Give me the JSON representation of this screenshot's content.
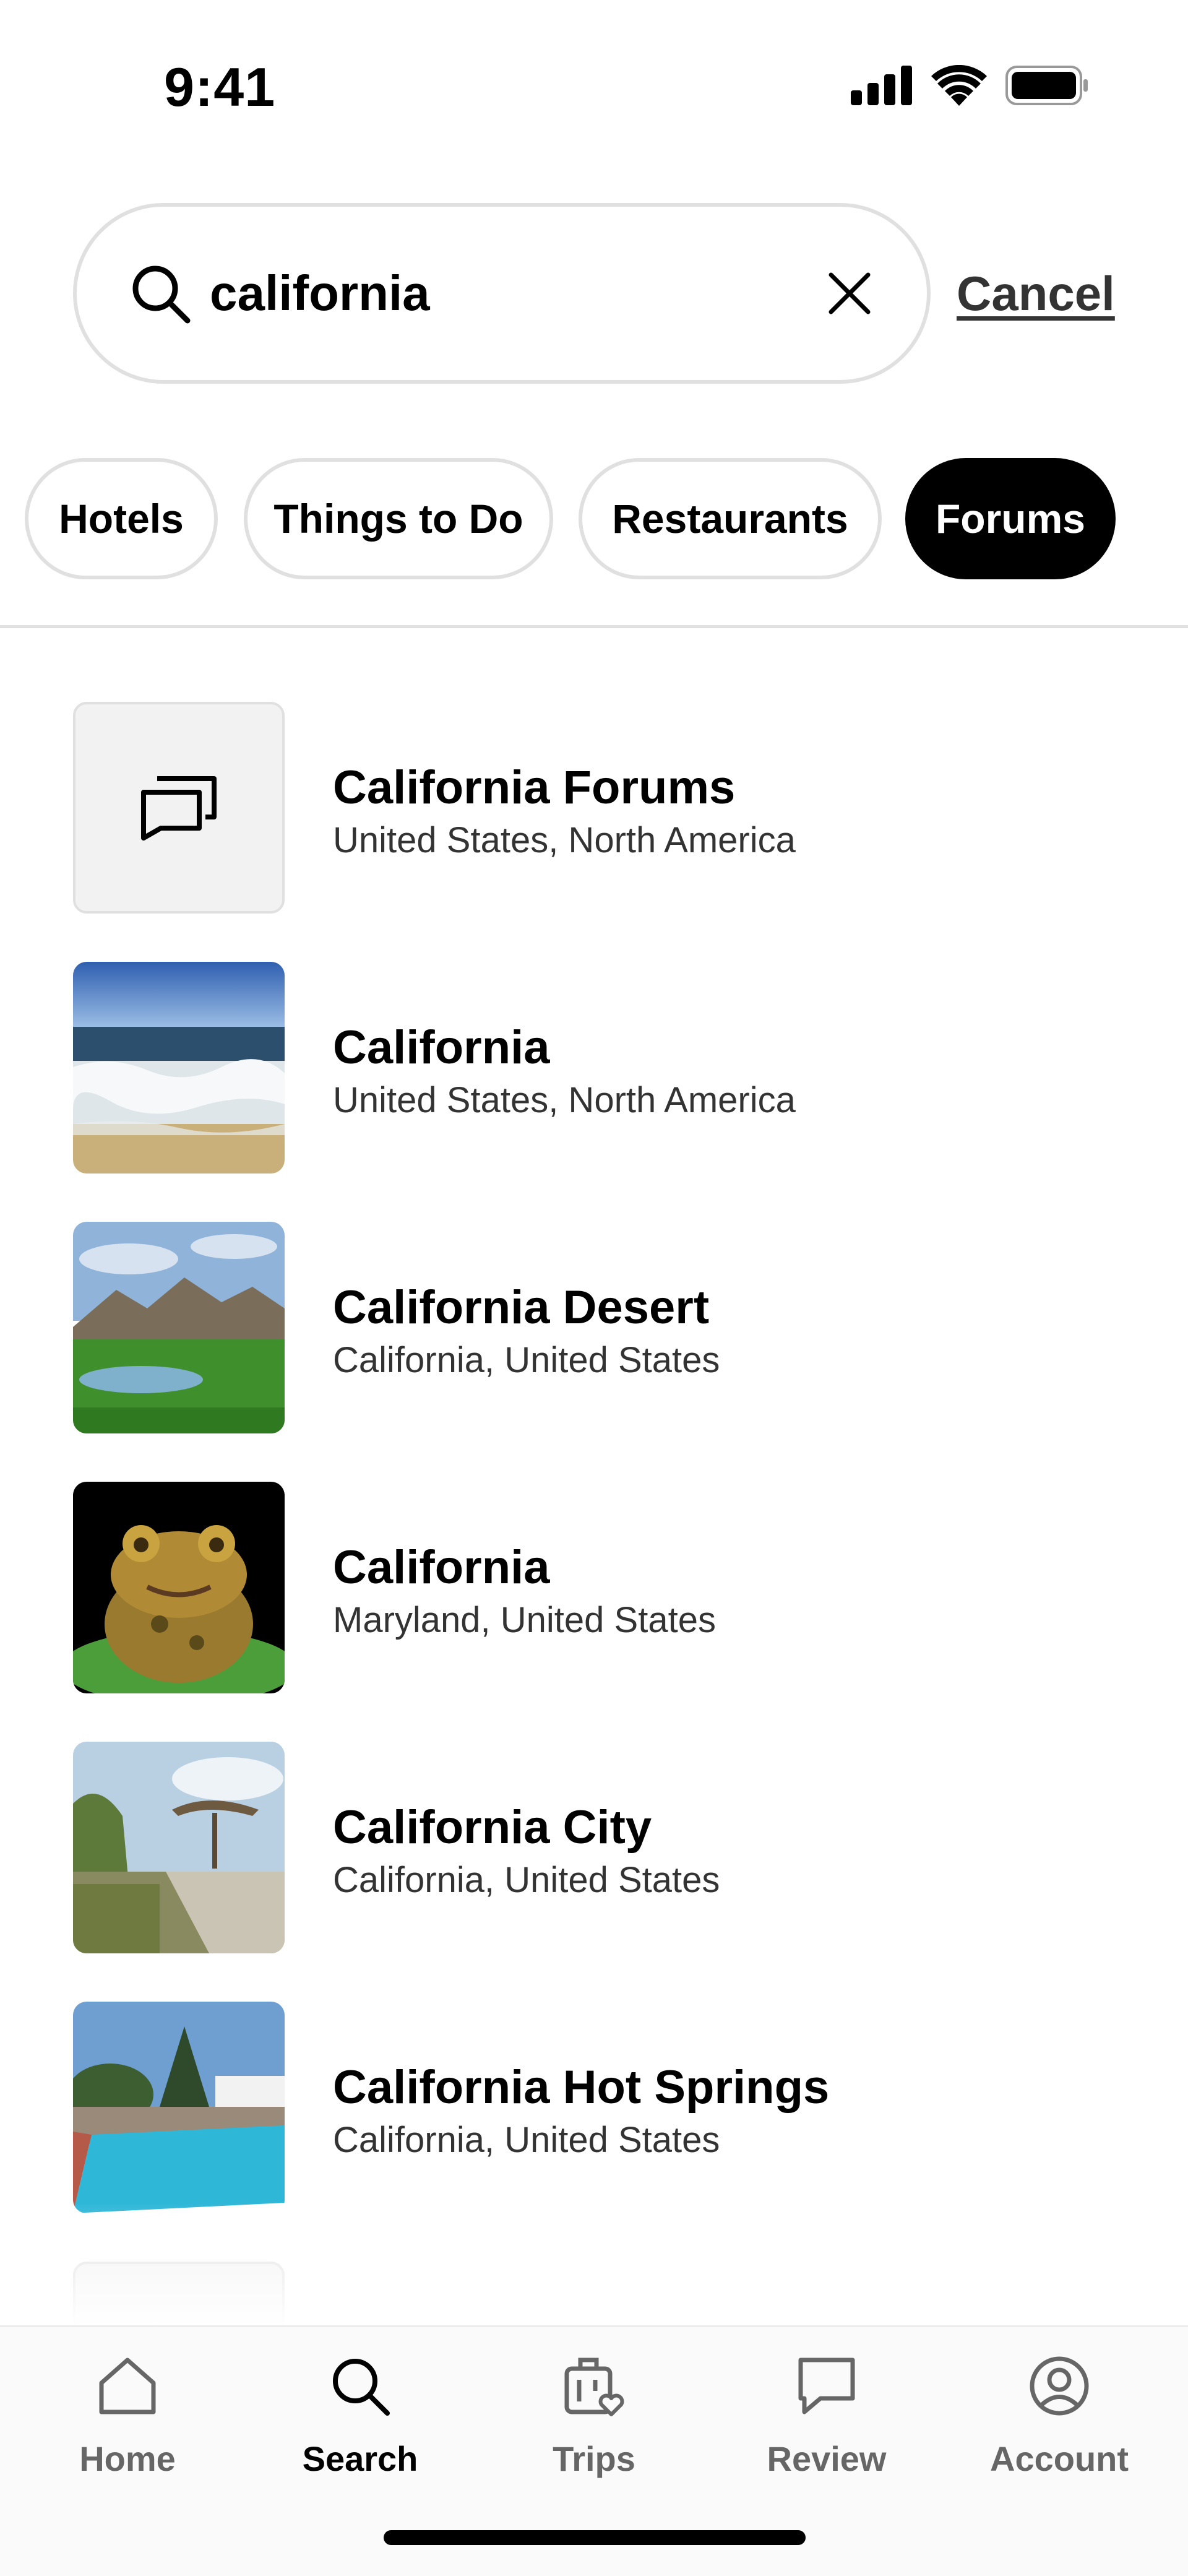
{
  "status_bar": {
    "time": "9:41"
  },
  "search": {
    "value": "california",
    "cancel_label": "Cancel"
  },
  "filters": [
    {
      "label": "Hotels",
      "active": false
    },
    {
      "label": "Things to Do",
      "active": false
    },
    {
      "label": "Restaurants",
      "active": false
    },
    {
      "label": "Forums",
      "active": true
    }
  ],
  "results": [
    {
      "title": "California Forums",
      "subtitle": "United States, North America",
      "thumb": "forum-icon"
    },
    {
      "title": "California",
      "subtitle": "United States, North America",
      "thumb": "ocean-beach-photo"
    },
    {
      "title": "California Desert",
      "subtitle": "California, United States",
      "thumb": "mountain-golf-photo"
    },
    {
      "title": "California",
      "subtitle": "Maryland, United States",
      "thumb": "toad-photo"
    },
    {
      "title": "California City",
      "subtitle": "California, United States",
      "thumb": "park-structure-photo"
    },
    {
      "title": "California Hot Springs",
      "subtitle": "California, United States",
      "thumb": "pool-photo"
    }
  ],
  "tabbar": {
    "items": [
      {
        "label": "Home",
        "icon": "home-icon",
        "active": false
      },
      {
        "label": "Search",
        "icon": "search-icon",
        "active": true
      },
      {
        "label": "Trips",
        "icon": "suitcase-heart-icon",
        "active": false
      },
      {
        "label": "Review",
        "icon": "speech-bubble-icon",
        "active": false
      },
      {
        "label": "Account",
        "icon": "user-circle-icon",
        "active": false
      }
    ]
  },
  "colors": {
    "active_chip_bg": "#000000",
    "chip_border": "#e0e0e0",
    "inactive_tab": "#666666"
  }
}
